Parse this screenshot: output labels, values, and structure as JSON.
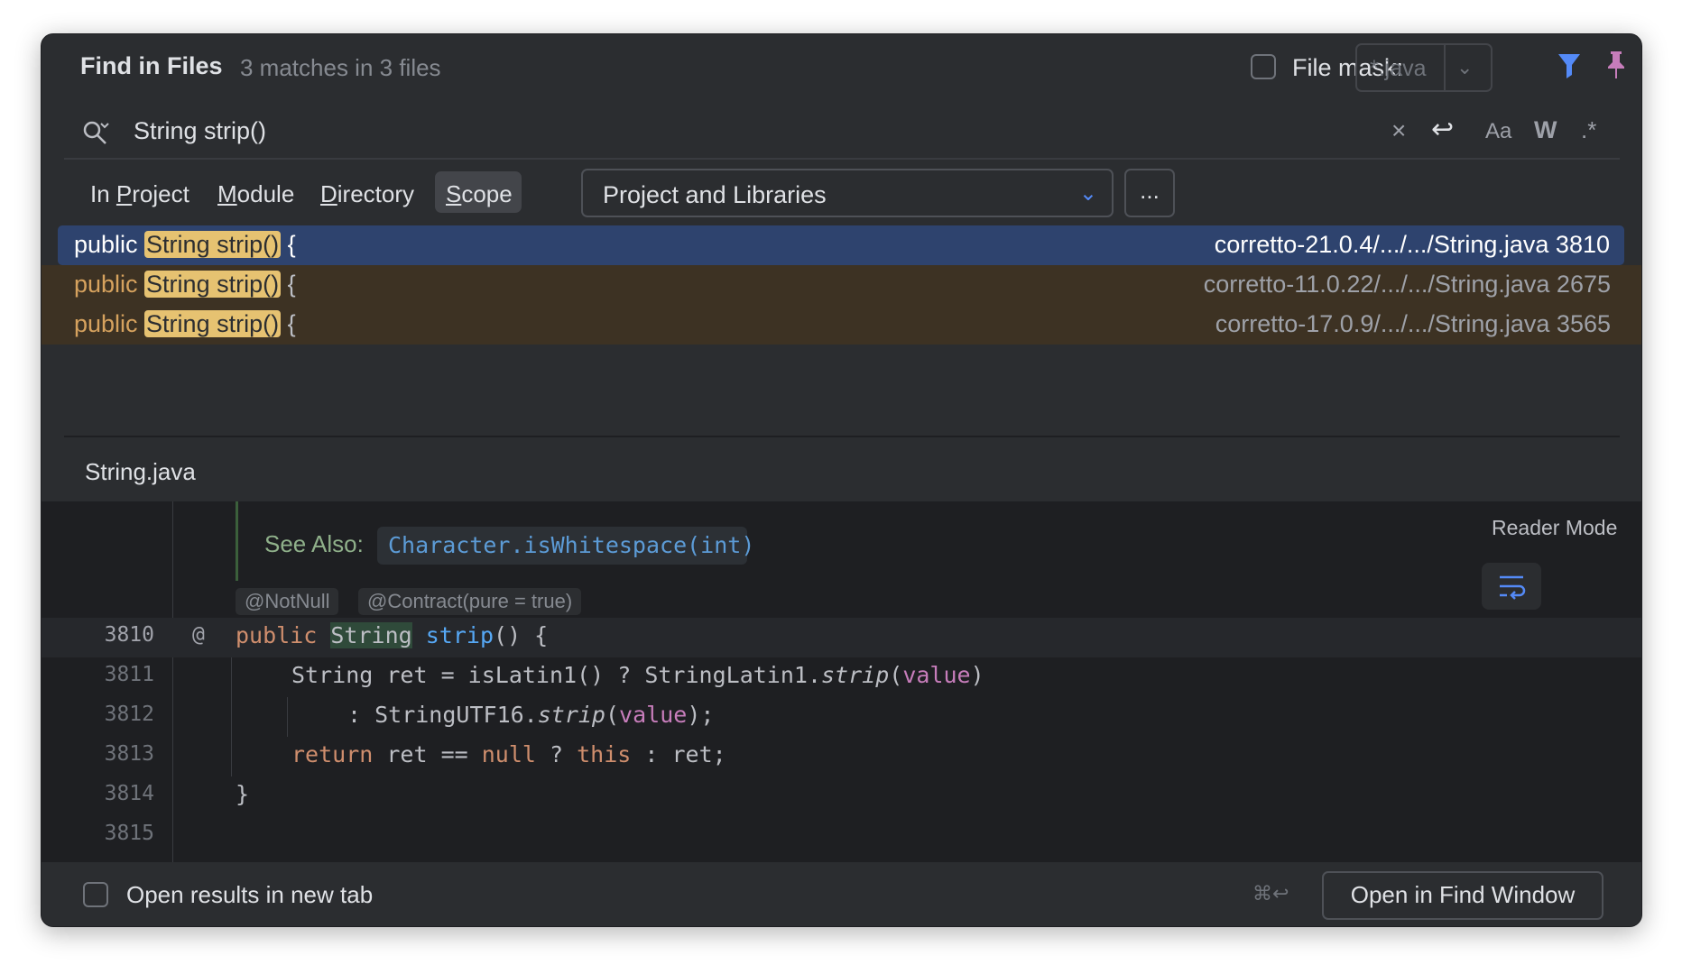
{
  "header": {
    "title": "Find in Files",
    "match_summary": "3 matches in 3 files",
    "file_mask_label": "File mask:",
    "file_mask_value": "*.java",
    "file_mask_checked": false
  },
  "search": {
    "query": "String strip()",
    "options": {
      "match_case": "Aa",
      "words": "W",
      "regex": ".*"
    }
  },
  "scope": {
    "tabs": [
      {
        "pre": "In ",
        "mn": "P",
        "post": "roject",
        "active": false
      },
      {
        "pre": "",
        "mn": "M",
        "post": "odule",
        "active": false
      },
      {
        "pre": "",
        "mn": "D",
        "post": "irectory",
        "active": false
      },
      {
        "pre": "",
        "mn": "S",
        "post": "cope",
        "active": true
      }
    ],
    "selected": "Project and Libraries",
    "more_label": "..."
  },
  "results": [
    {
      "prefix": "public ",
      "match": "String strip()",
      "suffix": " {",
      "file": "corretto-21.0.4/.../.../String.java 3810",
      "selected": true
    },
    {
      "prefix": "public ",
      "match": "String strip()",
      "suffix": " {",
      "file": "corretto-11.0.22/.../.../String.java 2675",
      "selected": false
    },
    {
      "prefix": "public ",
      "match": "String strip()",
      "suffix": " {",
      "file": "corretto-17.0.9/.../.../String.java 3565",
      "selected": false
    }
  ],
  "preview": {
    "filename": "String.java",
    "see_also_label": "See Also:",
    "see_also_link": "Character.isWhitespace(int)",
    "reader_mode": "Reader Mode",
    "annotations": [
      "@NotNull",
      "@Contract(pure = true)"
    ],
    "gutter_marker": "@",
    "line_numbers": [
      "3810",
      "3811",
      "3812",
      "3813",
      "3814",
      "3815"
    ],
    "code": {
      "l1": {
        "kw": "public",
        "sp": " ",
        "match": "String",
        "sp2": " ",
        "fn": "strip",
        "rest": "() {"
      },
      "l2": {
        "a": "String ret = isLatin1() ? StringLatin1.",
        "it": "strip",
        "b": "(",
        "fld": "value",
        "c": ")"
      },
      "l3": {
        "a": ": StringUTF16.",
        "it": "strip",
        "b": "(",
        "fld": "value",
        "c": ");"
      },
      "l4": {
        "kw1": "return",
        "a": " ret == ",
        "kw2": "null",
        "b": " ? ",
        "kw3": "this",
        "c": " : ret;"
      },
      "l5": {
        "a": "}"
      }
    }
  },
  "footer": {
    "open_new_tab_label": "Open results in new tab",
    "open_new_tab_checked": false,
    "shortcut": "⌘↩",
    "open_find_window": "Open in Find Window"
  },
  "colors": {
    "accent": "#548af7",
    "pin": "#c77dbb",
    "selection": "#2e436e",
    "match_highlight": "#e6c271"
  }
}
